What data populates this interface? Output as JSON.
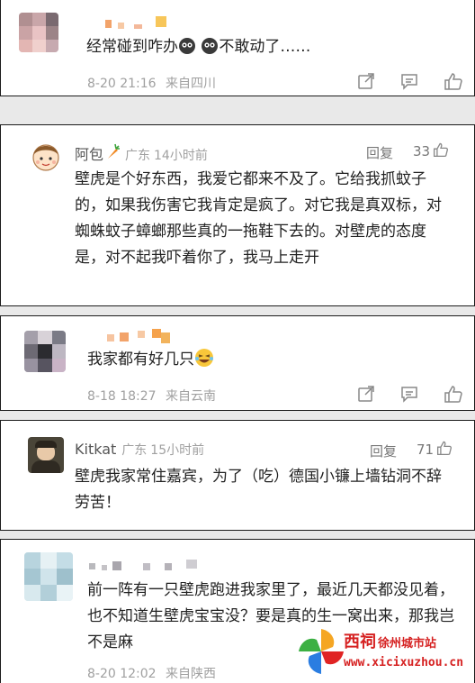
{
  "comments": [
    {
      "text": "经常碰到咋办",
      "text_tail": "不敢动了……",
      "date": "8-20 21:16",
      "source": "来自四川"
    },
    {
      "username": "阿包",
      "location": "广东",
      "time_ago": "14小时前",
      "reply_label": "回复",
      "likes": "33",
      "text": "壁虎是个好东西，我爱它都来不及了。它给我抓蚊子的，如果我伤害它我肯定是疯了。对它我是真双标，对蜘蛛蚊子蟑螂那些真的一拖鞋下去的。对壁虎的态度是，对不起我吓着你了，我马上走开"
    },
    {
      "text": "我家都有好几只",
      "date": "8-18 18:27",
      "source": "来自云南"
    },
    {
      "username": "Kitkat",
      "location": "广东",
      "time_ago": "15小时前",
      "reply_label": "回复",
      "likes": "71",
      "text": "壁虎我家常住嘉宾，为了（吃）德国小镰上墙钻洞不辞劳苦！"
    },
    {
      "text": "前一阵有一只壁虎跑进我家里了，最近几天都没见着，也不知道生壁虎宝宝没？要是真的生一窝出来，那我岂不是麻",
      "date": "8-20 12:02",
      "source": "来自陕西"
    }
  ],
  "watermark": {
    "brand": "西祠",
    "sub": "徐州城市站",
    "url": "www.xicixuzhou.cn"
  },
  "colors": {
    "meta_gray": "#a0a0a0",
    "border": "#1c1c1c",
    "watermark_red": "#d62222"
  }
}
